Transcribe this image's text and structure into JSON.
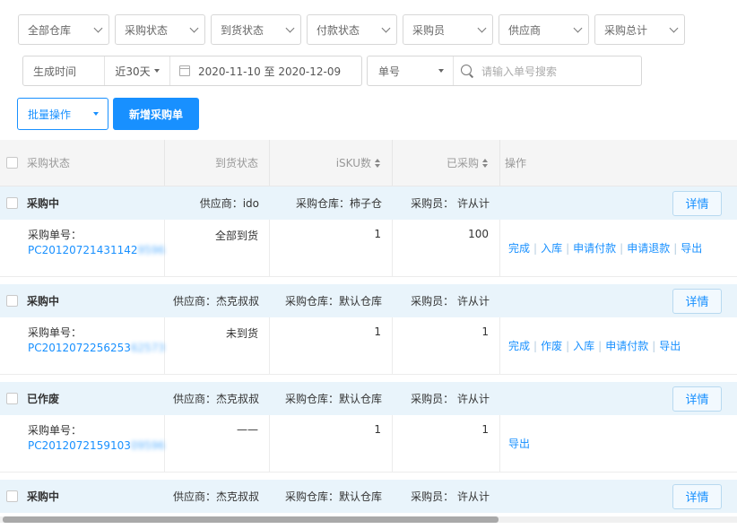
{
  "filters": [
    {
      "label": "全部仓库",
      "width": 102
    },
    {
      "label": "采购状态",
      "width": 101
    },
    {
      "label": "到货状态",
      "width": 101
    },
    {
      "label": "付款状态",
      "width": 101
    },
    {
      "label": "采购员",
      "width": 101
    },
    {
      "label": "供应商",
      "width": 101
    },
    {
      "label": "采购总计",
      "width": 101
    }
  ],
  "date_filter": {
    "label": "生成时间",
    "range": "近30天",
    "dates": "2020-11-10 至 2020-12-09"
  },
  "search": {
    "field": "单号",
    "placeholder": "请输入单号搜索"
  },
  "actions": {
    "batch": "批量操作",
    "new_order": "新增采购单"
  },
  "table": {
    "headers": [
      "采购状态",
      "到货状态",
      "iSKU数",
      "已采购",
      "操作"
    ],
    "detail_label": "详情",
    "po_label": "采购单号：",
    "groups": [
      {
        "status": "采购中",
        "supplier": "供应商：ido",
        "warehouse": "采购仓库：柿子仓",
        "buyer": "采购员：  许从计",
        "po_visible": "PC20120721431142",
        "po_blur": "9596",
        "arrival": "全部到货",
        "sku": "1",
        "purchased": "100",
        "ops": [
          "完成",
          "入库",
          "申请付款",
          "申请退款",
          "导出"
        ]
      },
      {
        "status": "采购中",
        "supplier": "供应商：杰克叔叔",
        "warehouse": "采购仓库：默认仓库",
        "buyer": "采购员：  许从计",
        "po_visible": "PC2012072256253",
        "po_blur": "62573",
        "arrival": "未到货",
        "sku": "1",
        "purchased": "1",
        "ops": [
          "完成",
          "作废",
          "入库",
          "申请付款",
          "导出"
        ]
      },
      {
        "status": "已作废",
        "supplier": "供应商：杰克叔叔",
        "warehouse": "采购仓库：默认仓库",
        "buyer": "采购员：  许从计",
        "po_visible": "PC2012072159103",
        "po_blur": "09596",
        "arrival": "——",
        "sku": "1",
        "purchased": "1",
        "ops": [
          "导出"
        ]
      },
      {
        "status": "采购中",
        "supplier": "供应商：杰克叔叔",
        "warehouse": "采购仓库：默认仓库",
        "buyer": "采购员：  许从计"
      }
    ]
  },
  "colors": {
    "accent": "#1890ff",
    "row_header_bg": "#e9f4fb"
  }
}
